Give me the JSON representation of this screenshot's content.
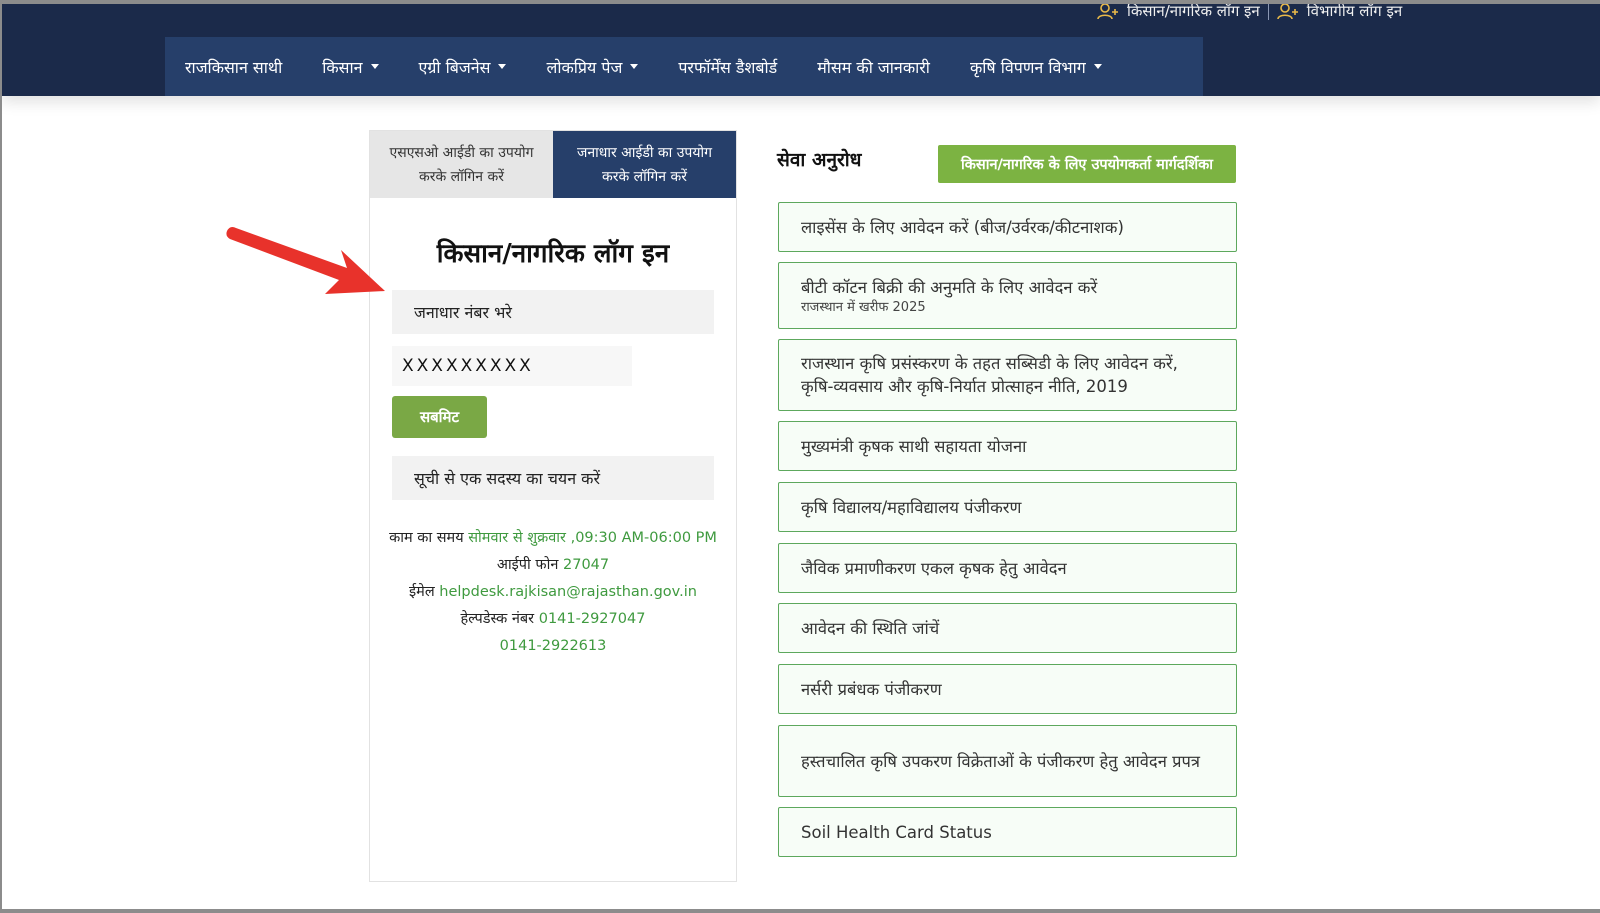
{
  "header": {
    "top_links": [
      {
        "label": "किसान/नागरिक लॉग इन",
        "icon": "user-icon"
      },
      {
        "label": "विभागीय लॉग इन",
        "icon": "user-icon"
      }
    ],
    "nav": [
      {
        "label": "राजकिसान साथी",
        "dropdown": false
      },
      {
        "label": "किसान",
        "dropdown": true
      },
      {
        "label": "एग्री बिजनेस",
        "dropdown": true
      },
      {
        "label": "लोकप्रिय पेज",
        "dropdown": true
      },
      {
        "label": "परफॉर्मेंस डैशबोर्ड",
        "dropdown": false
      },
      {
        "label": "मौसम की जानकारी",
        "dropdown": false
      },
      {
        "label": "कृषि विपणन विभाग",
        "dropdown": true
      }
    ]
  },
  "login": {
    "tabs": [
      {
        "label": "एसएसओ आईडी का उपयोग करके लॉगिन करें",
        "active": false
      },
      {
        "label": "जनाधार आईडी का उपयोग करके लॉगिन करें",
        "active": true
      }
    ],
    "title": "किसान/नागरिक लॉग इन",
    "janadhar_placeholder": "जनाधार नंबर भरे",
    "janadhar_value": "XXXXXXXXX",
    "submit_label": "सबमिट",
    "member_select": "सूची से एक सदस्य का चयन करें",
    "contact": {
      "work_time_label": "काम का समय",
      "work_time_value": "सोमवार से शुक्रवार ,09:30 AM-06:00 PM",
      "ip_phone_label": "आईपी फोन",
      "ip_phone_value": "27047",
      "email_label": "ईमेल",
      "email_value": "helpdesk.rajkisan@rajasthan.gov.in",
      "helpdesk_label": "हेल्पडेस्क नंबर",
      "helpdesk_value1": "0141-2927047",
      "helpdesk_value2": "0141-2922613"
    }
  },
  "services": {
    "heading": "सेवा अनुरोध",
    "guide_button": "किसान/नागरिक के लिए उपयोगकर्ता मार्गदर्शिका",
    "items": [
      {
        "label": "लाइसेंस के लिए आवेदन करें (बीज/उर्वरक/कीटनाशक)",
        "sub": ""
      },
      {
        "label": "बीटी कॉटन बिक्री की अनुमति के लिए आवेदन करें",
        "sub": "राजस्थान में खरीफ 2025"
      },
      {
        "label": "राजस्थान कृषि प्रसंस्करण के तहत सब्सिडी के लिए आवेदन करें, कृषि-व्यवसाय और कृषि-निर्यात प्रोत्साहन नीति, 2019",
        "sub": ""
      },
      {
        "label": "मुख्यमंत्री कृषक साथी सहायता योजना",
        "sub": ""
      },
      {
        "label": "कृषि विद्यालय/महाविद्यालय पंजीकरण",
        "sub": ""
      },
      {
        "label": "जैविक प्रमाणीकरण एकल कृषक हेतु आवेदन",
        "sub": ""
      },
      {
        "label": "आवेदन की स्थिति जांचें",
        "sub": ""
      },
      {
        "label": "नर्सरी प्रबंधक पंजीकरण",
        "sub": ""
      },
      {
        "label": "हस्तचालित कृषि उपकरण विक्रेताओं के पंजीकरण हेतु आवेदन प्रपत्र",
        "sub": ""
      },
      {
        "label": "Soil Health Card Status",
        "sub": ""
      }
    ]
  },
  "colors": {
    "header_bg": "#1b2a4a",
    "nav_bg": "#263f6a",
    "accent_green": "#7cb342",
    "service_border": "#5da85d",
    "annotation_arrow": "#e8322b"
  }
}
